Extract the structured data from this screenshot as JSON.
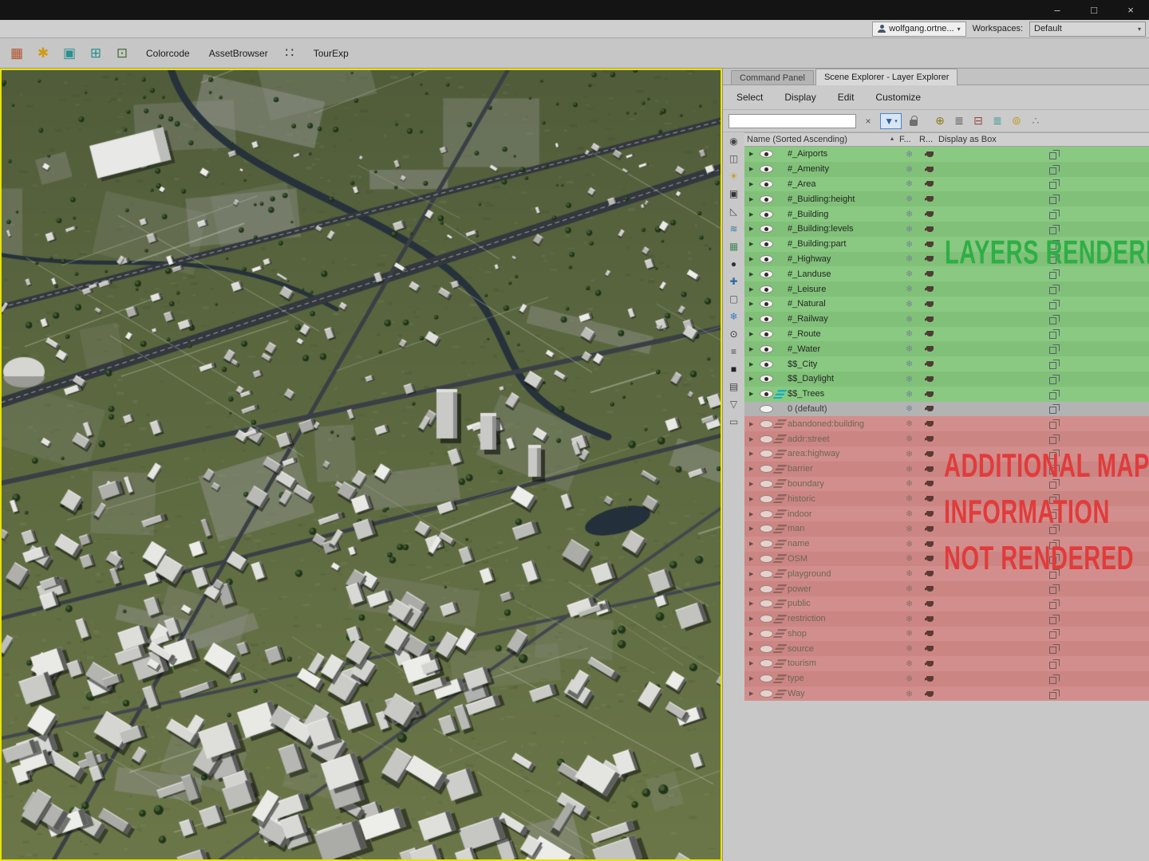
{
  "window": {
    "controls": {
      "minimize": "–",
      "maximize": "□",
      "close": "×"
    }
  },
  "account_bar": {
    "user": "wolfgang.ortne...",
    "caret": "▾",
    "workspaces_label": "Workspaces:",
    "workspace_value": "Default"
  },
  "toolbar": {
    "items": [
      {
        "kind": "icon",
        "name": "scene-table-icon",
        "text": "▦",
        "color": "#b2542e"
      },
      {
        "kind": "icon",
        "name": "utilities-gear-icon",
        "text": "✱",
        "color": "#d29a12"
      },
      {
        "kind": "icon",
        "name": "export-box-icon",
        "text": "▣",
        "color": "#2b8f8f"
      },
      {
        "kind": "icon",
        "name": "import-box-icon",
        "text": "⊞",
        "color": "#2b8f8f"
      },
      {
        "kind": "icon",
        "name": "capture-tool-icon",
        "text": "⊡",
        "color": "#4a6a3a"
      },
      {
        "kind": "label",
        "name": "colorcode-button",
        "text": "Colorcode"
      },
      {
        "kind": "label",
        "name": "assetbrowser-button",
        "text": "AssetBrowser"
      },
      {
        "kind": "icon",
        "name": "grid-windows-icon",
        "text": "∷",
        "color": "#333333"
      },
      {
        "kind": "label",
        "name": "tourexp-button",
        "text": "TourExp"
      }
    ]
  },
  "panel": {
    "tabs": [
      {
        "name": "tab-command-panel",
        "text": "Command Panel"
      },
      {
        "name": "tab-scene-explorer-layer-explorer",
        "text": "Scene Explorer - Layer Explorer",
        "active": true
      }
    ],
    "menus": [
      {
        "name": "menu-select",
        "text": "Select"
      },
      {
        "name": "menu-display",
        "text": "Display"
      },
      {
        "name": "menu-edit",
        "text": "Edit"
      },
      {
        "name": "menu-customize",
        "text": "Customize"
      }
    ],
    "search": {
      "value": "",
      "clear_glyph": "×",
      "filter_glyph": "▼",
      "filter_caret": "▾"
    },
    "layer_tools": [
      {
        "name": "create-new-layer-icon",
        "text": "⊕",
        "color": "#8a7a1a"
      },
      {
        "name": "add-to-layer-icon",
        "text": "≣",
        "color": "#4a4a4a"
      },
      {
        "name": "delete-layer-icon",
        "text": "⊟",
        "color": "#9a4a42"
      },
      {
        "name": "select-layer-icon",
        "text": "≣",
        "color": "#2b8f8f"
      },
      {
        "name": "highlight-layer-icon",
        "text": "⊚",
        "color": "#c09a20"
      },
      {
        "name": "collapse-all-icon",
        "text": "∴",
        "color": "#777777"
      }
    ],
    "side_icons": [
      {
        "name": "display-influences-icon",
        "text": "◉",
        "color": "#444444"
      },
      {
        "name": "display-geometry-icon",
        "text": "◫",
        "color": "#555555"
      },
      {
        "name": "display-lights-icon",
        "text": "☀",
        "color": "#c79a1f"
      },
      {
        "name": "display-cameras-icon",
        "text": "▣",
        "color": "#333333"
      },
      {
        "name": "display-helpers-icon",
        "text": "◺",
        "color": "#555555"
      },
      {
        "name": "display-spacewarps-icon",
        "text": "≋",
        "color": "#3a7a9a"
      },
      {
        "name": "display-bones-icon",
        "text": "▦",
        "color": "#46885a"
      },
      {
        "name": "display-particles-icon",
        "text": "●",
        "color": "#333333"
      },
      {
        "name": "display-probes-icon",
        "text": "✚",
        "color": "#2a6aa0"
      },
      {
        "name": "display-containers-icon",
        "text": "▢",
        "color": "#555555"
      },
      {
        "name": "display-frozen-icon",
        "text": "❄",
        "color": "#3a7ac0"
      },
      {
        "name": "display-hidden-icon",
        "text": "⊙",
        "color": "#333333"
      },
      {
        "name": "list-view-icon",
        "text": "≡",
        "color": "#444444"
      },
      {
        "name": "display-shapes-icon",
        "text": "■",
        "color": "#222222"
      },
      {
        "name": "properties-icon",
        "text": "▤",
        "color": "#444444"
      },
      {
        "name": "filter-funnel-icon",
        "text": "▽",
        "color": "#555555"
      },
      {
        "name": "archive-icon",
        "text": "▭",
        "color": "#555555"
      }
    ],
    "columns": {
      "name": "Name (Sorted Ascending)",
      "sort_glyph": "▴",
      "frozen": "F...",
      "render": "R...",
      "display": "Display as Box"
    },
    "row_glyphs": {
      "expand": "▶",
      "freeze": "❄"
    },
    "rows": [
      {
        "label": "#_Airports",
        "group": "rendered"
      },
      {
        "label": "#_Amenity",
        "group": "rendered"
      },
      {
        "label": "#_Area",
        "group": "rendered"
      },
      {
        "label": "#_Buidling:height",
        "group": "rendered"
      },
      {
        "label": "#_Building",
        "group": "rendered"
      },
      {
        "label": "#_Building:levels",
        "group": "rendered"
      },
      {
        "label": "#_Building:part",
        "group": "rendered"
      },
      {
        "label": "#_Highway",
        "group": "rendered"
      },
      {
        "label": "#_Landuse",
        "group": "rendered"
      },
      {
        "label": "#_Leisure",
        "group": "rendered"
      },
      {
        "label": "#_Natural",
        "group": "rendered"
      },
      {
        "label": "#_Railway",
        "group": "rendered"
      },
      {
        "label": "#_Route",
        "group": "rendered"
      },
      {
        "label": "#_Water",
        "group": "rendered"
      },
      {
        "label": "$$_City",
        "group": "rendered"
      },
      {
        "label": "$$_Daylight",
        "group": "rendered"
      },
      {
        "label": "$$_Trees",
        "group": "rendered",
        "active": true
      },
      {
        "label": "0 (default)",
        "group": "default"
      },
      {
        "label": "abandoned:building",
        "group": "hidden"
      },
      {
        "label": "addr:street",
        "group": "hidden"
      },
      {
        "label": "area:highway",
        "group": "hidden"
      },
      {
        "label": "barrier",
        "group": "hidden"
      },
      {
        "label": "boundary",
        "group": "hidden"
      },
      {
        "label": "historic",
        "group": "hidden"
      },
      {
        "label": "indoor",
        "group": "hidden"
      },
      {
        "label": "man",
        "group": "hidden"
      },
      {
        "label": "name",
        "group": "hidden"
      },
      {
        "label": "OSM",
        "group": "hidden"
      },
      {
        "label": "playground",
        "group": "hidden"
      },
      {
        "label": "power",
        "group": "hidden"
      },
      {
        "label": "public",
        "group": "hidden"
      },
      {
        "label": "restriction",
        "group": "hidden"
      },
      {
        "label": "shop",
        "group": "hidden"
      },
      {
        "label": "source",
        "group": "hidden"
      },
      {
        "label": "tourism",
        "group": "hidden"
      },
      {
        "label": "type",
        "group": "hidden"
      },
      {
        "label": "Way",
        "group": "hidden"
      }
    ],
    "annotations": {
      "rendered": "LAYERS RENDERED",
      "not_rendered_lines": [
        "ADDITIONAL MAP",
        "INFORMATION",
        "NOT RENDERED"
      ],
      "green": "#2fae46",
      "red": "#e13b3b"
    }
  }
}
